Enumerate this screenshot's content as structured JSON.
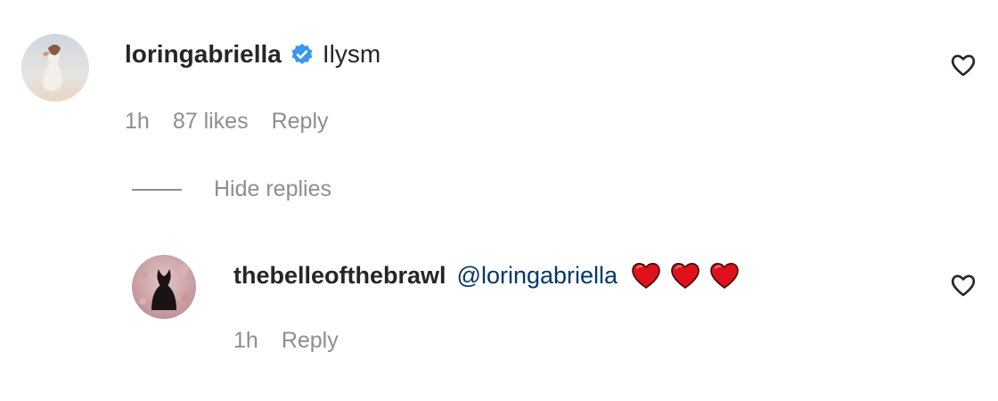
{
  "comment": {
    "username": "loringabriella",
    "text": "Ilysm",
    "time": "1h",
    "likes": "87 likes",
    "reply_label": "Reply",
    "verified_icon": "verified-badge-icon",
    "like_icon": "heart-outline-icon"
  },
  "replies_toggle": {
    "label": "Hide replies"
  },
  "reply": {
    "username": "thebelleofthebrawl",
    "mention": "@loringabriella",
    "emoji": [
      "red-heart",
      "red-heart",
      "red-heart"
    ],
    "time": "1h",
    "reply_label": "Reply",
    "like_icon": "heart-outline-icon"
  },
  "colors": {
    "text_primary": "#262626",
    "text_secondary": "#8e8e8e",
    "mention": "#00376b",
    "verified": "#3897f0",
    "emoji_heart": "#e0111b"
  }
}
